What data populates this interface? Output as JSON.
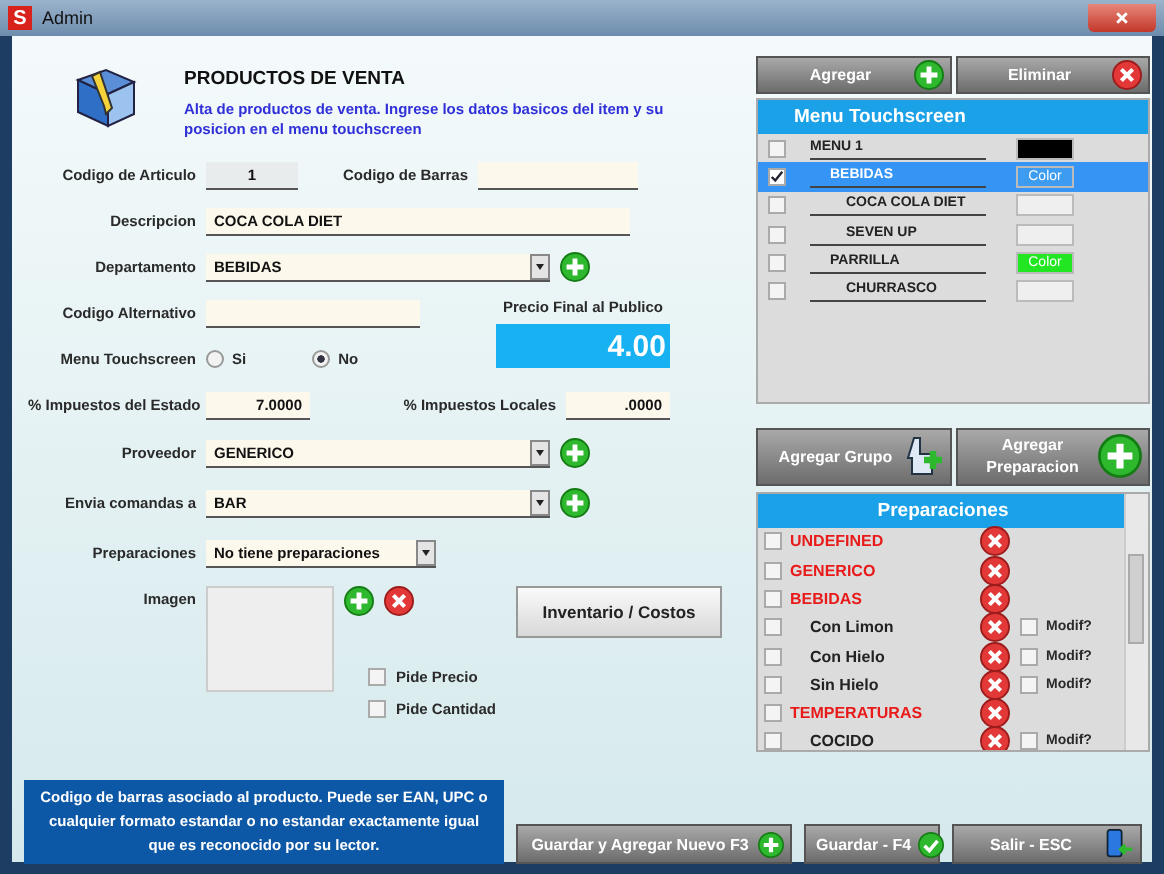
{
  "window": {
    "title": "Admin",
    "app_icon": "S"
  },
  "header": {
    "title": "PRODUCTOS DE VENTA",
    "subtitle": "Alta de productos de venta. Ingrese los datos basicos del item y su posicion en el menu touchscreen"
  },
  "codigo_articulo": {
    "label": "Codigo de Articulo",
    "value": "1"
  },
  "codigo_barras": {
    "label": "Codigo de Barras"
  },
  "descripcion": {
    "label": "Descripcion",
    "value": "COCA COLA DIET"
  },
  "departamento": {
    "label": "Departamento",
    "value": "BEBIDAS"
  },
  "codigo_alternativo": {
    "label": "Codigo Alternativo"
  },
  "precio": {
    "label": "Precio Final al Publico",
    "value": "4.00"
  },
  "menu_touchscreen": {
    "label": "Menu Touchscreen",
    "options": [
      {
        "label": "Si",
        "selected": false
      },
      {
        "label": "No",
        "selected": true
      }
    ]
  },
  "impuestos_estado": {
    "label": "% Impuestos del Estado",
    "value": "7.0000"
  },
  "impuestos_locales": {
    "label": "% Impuestos Locales",
    "value": ".0000"
  },
  "proveedor": {
    "label": "Proveedor",
    "value": "GENERICO"
  },
  "envia_comandas": {
    "label": "Envia comandas a",
    "value": "BAR"
  },
  "preparaciones_field": {
    "label": "Preparaciones",
    "value": "No tiene preparaciones"
  },
  "imagen": {
    "label": "Imagen"
  },
  "inventory_button": "Inventario / Costos",
  "options": [
    {
      "label": "Pide Precio",
      "checked": false
    },
    {
      "label": "Pide Cantidad",
      "checked": false
    }
  ],
  "info": "Codigo de barras asociado al producto. Puede ser EAN, UPC o cualquier formato estandar o no estandar exactamente igual que es reconocido por su lector.",
  "menu_buttons": [
    {
      "label": "Agregar",
      "kind": "add"
    },
    {
      "label": "Eliminar",
      "kind": "delete"
    }
  ],
  "menu_panel": {
    "title": "Menu Touchscreen",
    "items": [
      {
        "label": "MENU 1",
        "checked": false,
        "selected": false,
        "color": "#000000",
        "children": [
          {
            "label": "BEBIDAS",
            "checked": true,
            "selected": true,
            "color": "#3d9bf0",
            "swatch_label": "Color",
            "children": [
              {
                "label": "COCA COLA DIET",
                "checked": false,
                "selected": false,
                "color": "#efefef"
              },
              {
                "label": "SEVEN UP",
                "checked": false,
                "selected": false,
                "color": "#efefef"
              }
            ]
          },
          {
            "label": "PARRILLA",
            "checked": false,
            "selected": false,
            "color": "#22e622",
            "swatch_label": "Color",
            "children": [
              {
                "label": "CHURRASCO",
                "checked": false,
                "selected": false,
                "color": "#efefef"
              }
            ]
          }
        ]
      }
    ]
  },
  "prep_buttons": [
    {
      "label": "Agregar Grupo",
      "kind": "group"
    },
    {
      "label": "Agregar Preparacion",
      "kind": "add"
    }
  ],
  "preparaciones": {
    "title": "Preparaciones",
    "items": [
      {
        "label": "UNDEFINED",
        "checked": false
      },
      {
        "label": "GENERICO",
        "checked": false
      },
      {
        "label": "BEBIDAS",
        "checked": false,
        "children": [
          {
            "label": "Con Limon",
            "checked": false,
            "modif": {
              "label": "Modif?",
              "checked": false
            }
          },
          {
            "label": "Con Hielo",
            "checked": false,
            "modif": {
              "label": "Modif?",
              "checked": false
            }
          },
          {
            "label": "Sin Hielo",
            "checked": false,
            "modif": {
              "label": "Modif?",
              "checked": false
            }
          }
        ]
      },
      {
        "label": "TEMPERATURAS",
        "checked": false,
        "children": [
          {
            "label": "COCIDO",
            "checked": false,
            "modif": {
              "label": "Modif?",
              "checked": false
            }
          }
        ]
      }
    ]
  },
  "footer_buttons": [
    {
      "label": "Guardar y Agregar Nuevo F3",
      "kind": "add"
    },
    {
      "label": "Guardar - F4",
      "kind": "save"
    },
    {
      "label": "Salir - ESC",
      "kind": "exit"
    }
  ]
}
